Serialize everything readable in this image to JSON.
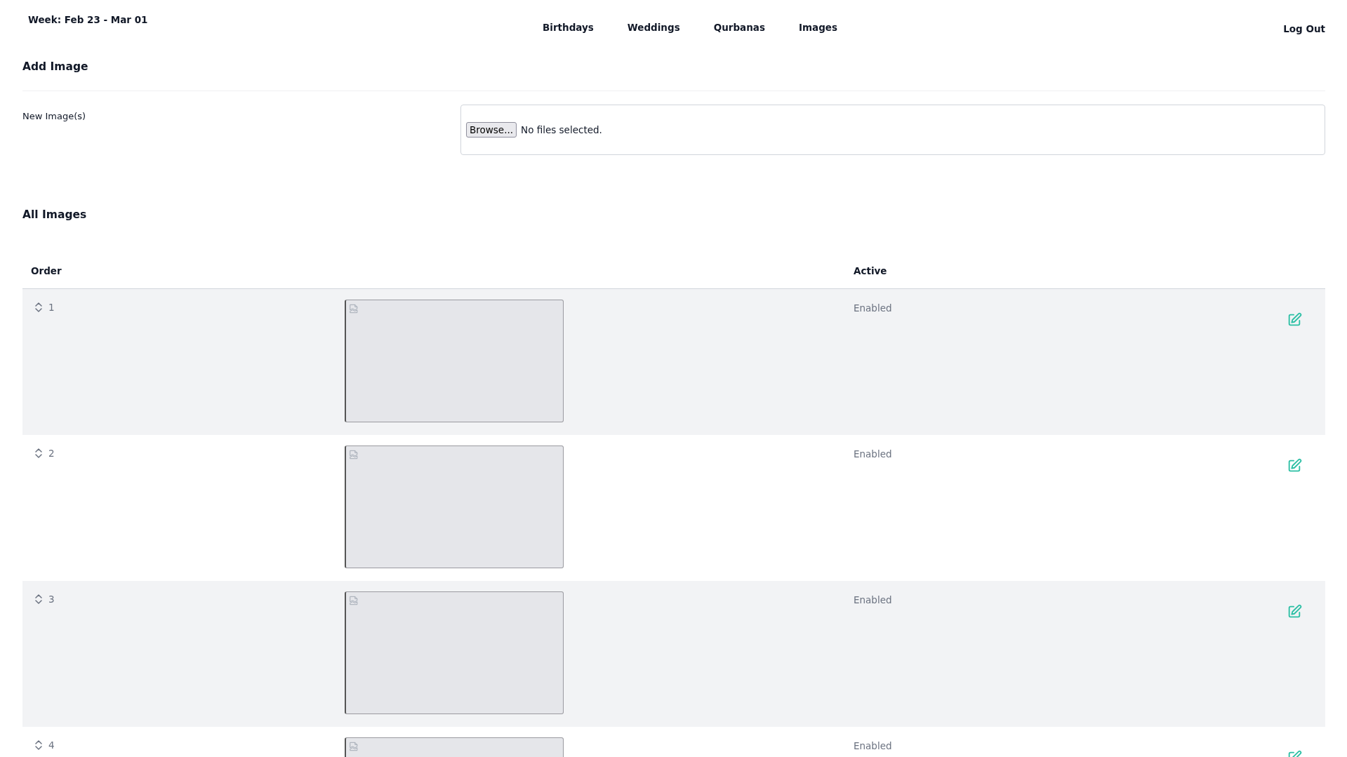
{
  "header": {
    "week": "Week: Feb 23 - Mar 01",
    "nav": [
      {
        "label": "Birthdays"
      },
      {
        "label": "Weddings"
      },
      {
        "label": "Qurbanas"
      },
      {
        "label": "Images"
      }
    ],
    "logout": "Log Out"
  },
  "add_image": {
    "heading": "Add Image",
    "field_label": "New Image(s)",
    "file_input": {
      "button": "Browse...",
      "status": "No files selected."
    }
  },
  "all_images": {
    "heading": "All Images",
    "columns": [
      "Order",
      "Active"
    ],
    "rows": [
      {
        "order": "1",
        "active": "Enabled"
      },
      {
        "order": "2",
        "active": "Enabled"
      },
      {
        "order": "3",
        "active": "Enabled"
      },
      {
        "order": "4",
        "active": "Enabled"
      }
    ]
  }
}
